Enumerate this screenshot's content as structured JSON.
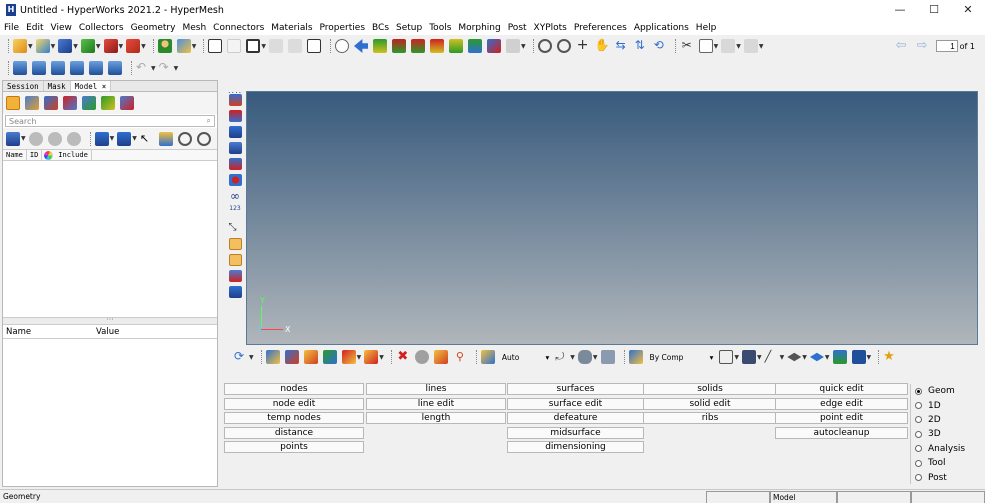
{
  "window": {
    "title": "Untitled - HyperWorks 2021.2 - HyperMesh",
    "app_icon": "H",
    "minimize": "—",
    "maximize": "☐",
    "close": "✕"
  },
  "menu": [
    "File",
    "Edit",
    "View",
    "Collectors",
    "Geometry",
    "Mesh",
    "Connectors",
    "Materials",
    "Properties",
    "BCs",
    "Setup",
    "Tools",
    "Morphing",
    "Post",
    "XYPlots",
    "Preferences",
    "Applications",
    "Help"
  ],
  "toolbar": {
    "page_value": "1",
    "page_of": "of 1"
  },
  "browser": {
    "tabs": [
      "Session",
      "Mask",
      "Model ×"
    ],
    "search_placeholder": "Search",
    "search_icon": "⌕",
    "columns": [
      "Name",
      "ID",
      "Include"
    ],
    "prop_columns": [
      "Name",
      "Value"
    ]
  },
  "vertical_toolbar": {
    "dots": "....",
    "icon_123": "123"
  },
  "viewport": {
    "axis_x": "X",
    "axis_y": "Y",
    "axis_z": "Z"
  },
  "view_toolbar": {
    "auto_select": "Auto",
    "color_mode": "By Comp"
  },
  "panel": {
    "col1": [
      "nodes",
      "node edit",
      "temp nodes",
      "distance",
      "points"
    ],
    "col2": [
      "lines",
      "line edit",
      "length"
    ],
    "col3": [
      "surfaces",
      "surface edit",
      "defeature",
      "midsurface",
      "dimensioning"
    ],
    "col4": [
      "solids",
      "solid edit",
      "ribs"
    ],
    "col5": [
      "quick edit",
      "edge edit",
      "point edit",
      "autocleanup"
    ]
  },
  "radio": {
    "options": [
      "Geom",
      "1D",
      "2D",
      "3D",
      "Analysis",
      "Tool",
      "Post"
    ],
    "selected": "Geom"
  },
  "status": {
    "left": "Geometry",
    "model": "Model"
  }
}
